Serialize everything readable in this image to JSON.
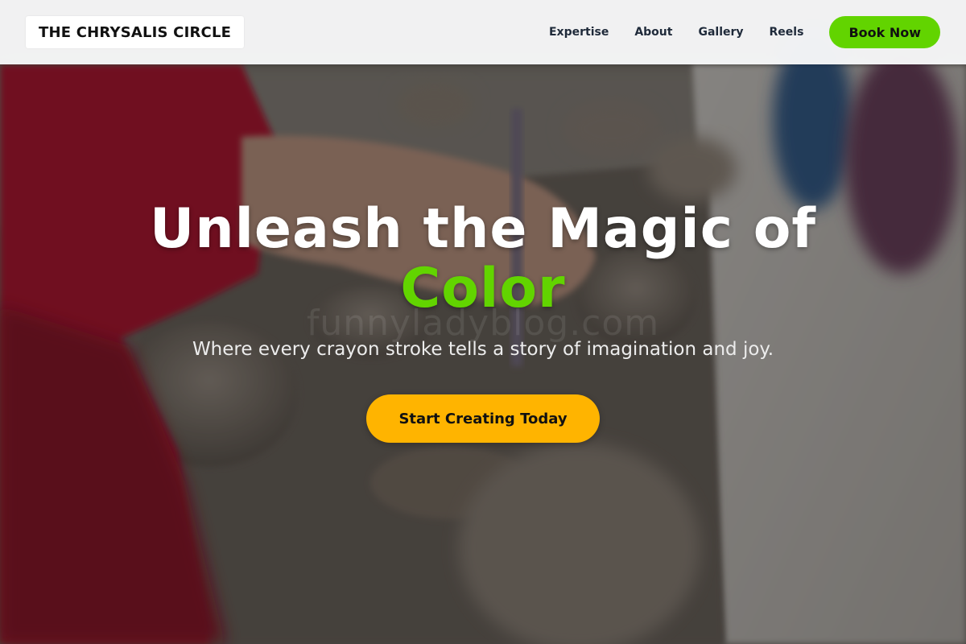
{
  "header": {
    "logo_text": "THE CHRYSALIS CIRCLE",
    "nav": [
      {
        "label": "Expertise"
      },
      {
        "label": "About"
      },
      {
        "label": "Gallery"
      },
      {
        "label": "Reels"
      }
    ],
    "book_button_label": "Book Now"
  },
  "hero": {
    "title_main": "Unleash the Magic of",
    "title_accent": "Color",
    "watermark": "funnyladyblog.com",
    "subtitle": "Where every crayon stroke tells a story of imagination and joy.",
    "cta_label": "Start Creating Today",
    "background_image": "pottery-class-photo"
  },
  "colors": {
    "accent_green": "#62d400",
    "cta_yellow": "#ffb400",
    "header_bg": "#f8f9fa",
    "nav_text": "#1f2a3a"
  }
}
